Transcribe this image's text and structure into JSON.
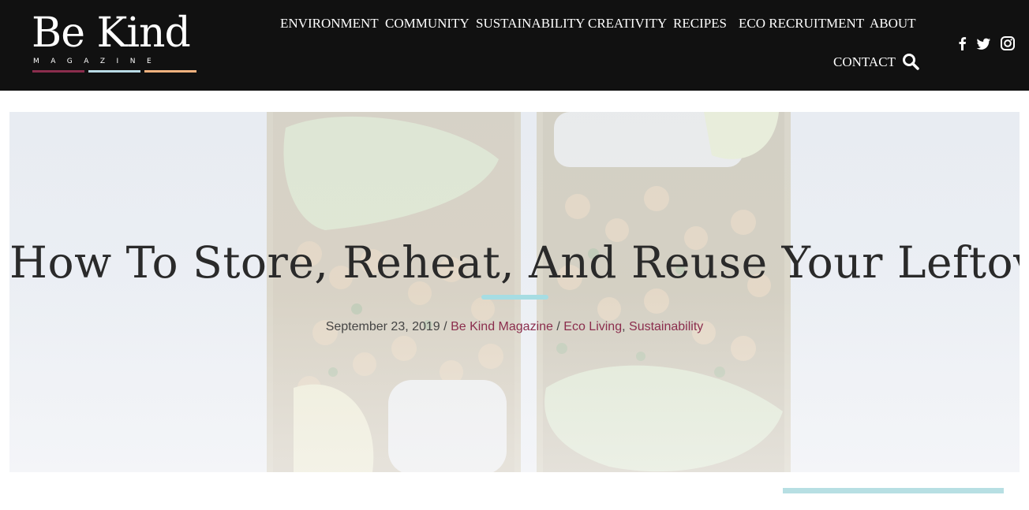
{
  "brand": {
    "title": "Be Kind",
    "subtitle": "MAGAZINE",
    "bar_colors": [
      "#8b2d4d",
      "#b9dbe6",
      "#f2b27f"
    ]
  },
  "nav": {
    "items": [
      {
        "label": "ENVIRONMENT"
      },
      {
        "label": "COMMUNITY"
      },
      {
        "label": "SUSTAINABILITY"
      },
      {
        "label": "CREATIVITY"
      },
      {
        "label": "RECIPES"
      },
      {
        "label": "ECO RECRUITMENT"
      },
      {
        "label": "ABOUT"
      },
      {
        "label": "CONTACT"
      }
    ],
    "search_icon": "search-icon"
  },
  "social": {
    "icons": [
      "facebook-icon",
      "twitter-icon",
      "instagram-icon"
    ]
  },
  "article": {
    "title": "How To Store, Reheat, And Reuse Your Leftovers",
    "date": "September 23, 2019",
    "author": "Be Kind Magazine",
    "categories": [
      "Eco Living",
      "Sustainability"
    ],
    "separator": "/",
    "category_separator": ","
  },
  "colors": {
    "header_bg": "#111111",
    "accent_teal": "#a6dde3",
    "link": "#8b2d4d"
  }
}
